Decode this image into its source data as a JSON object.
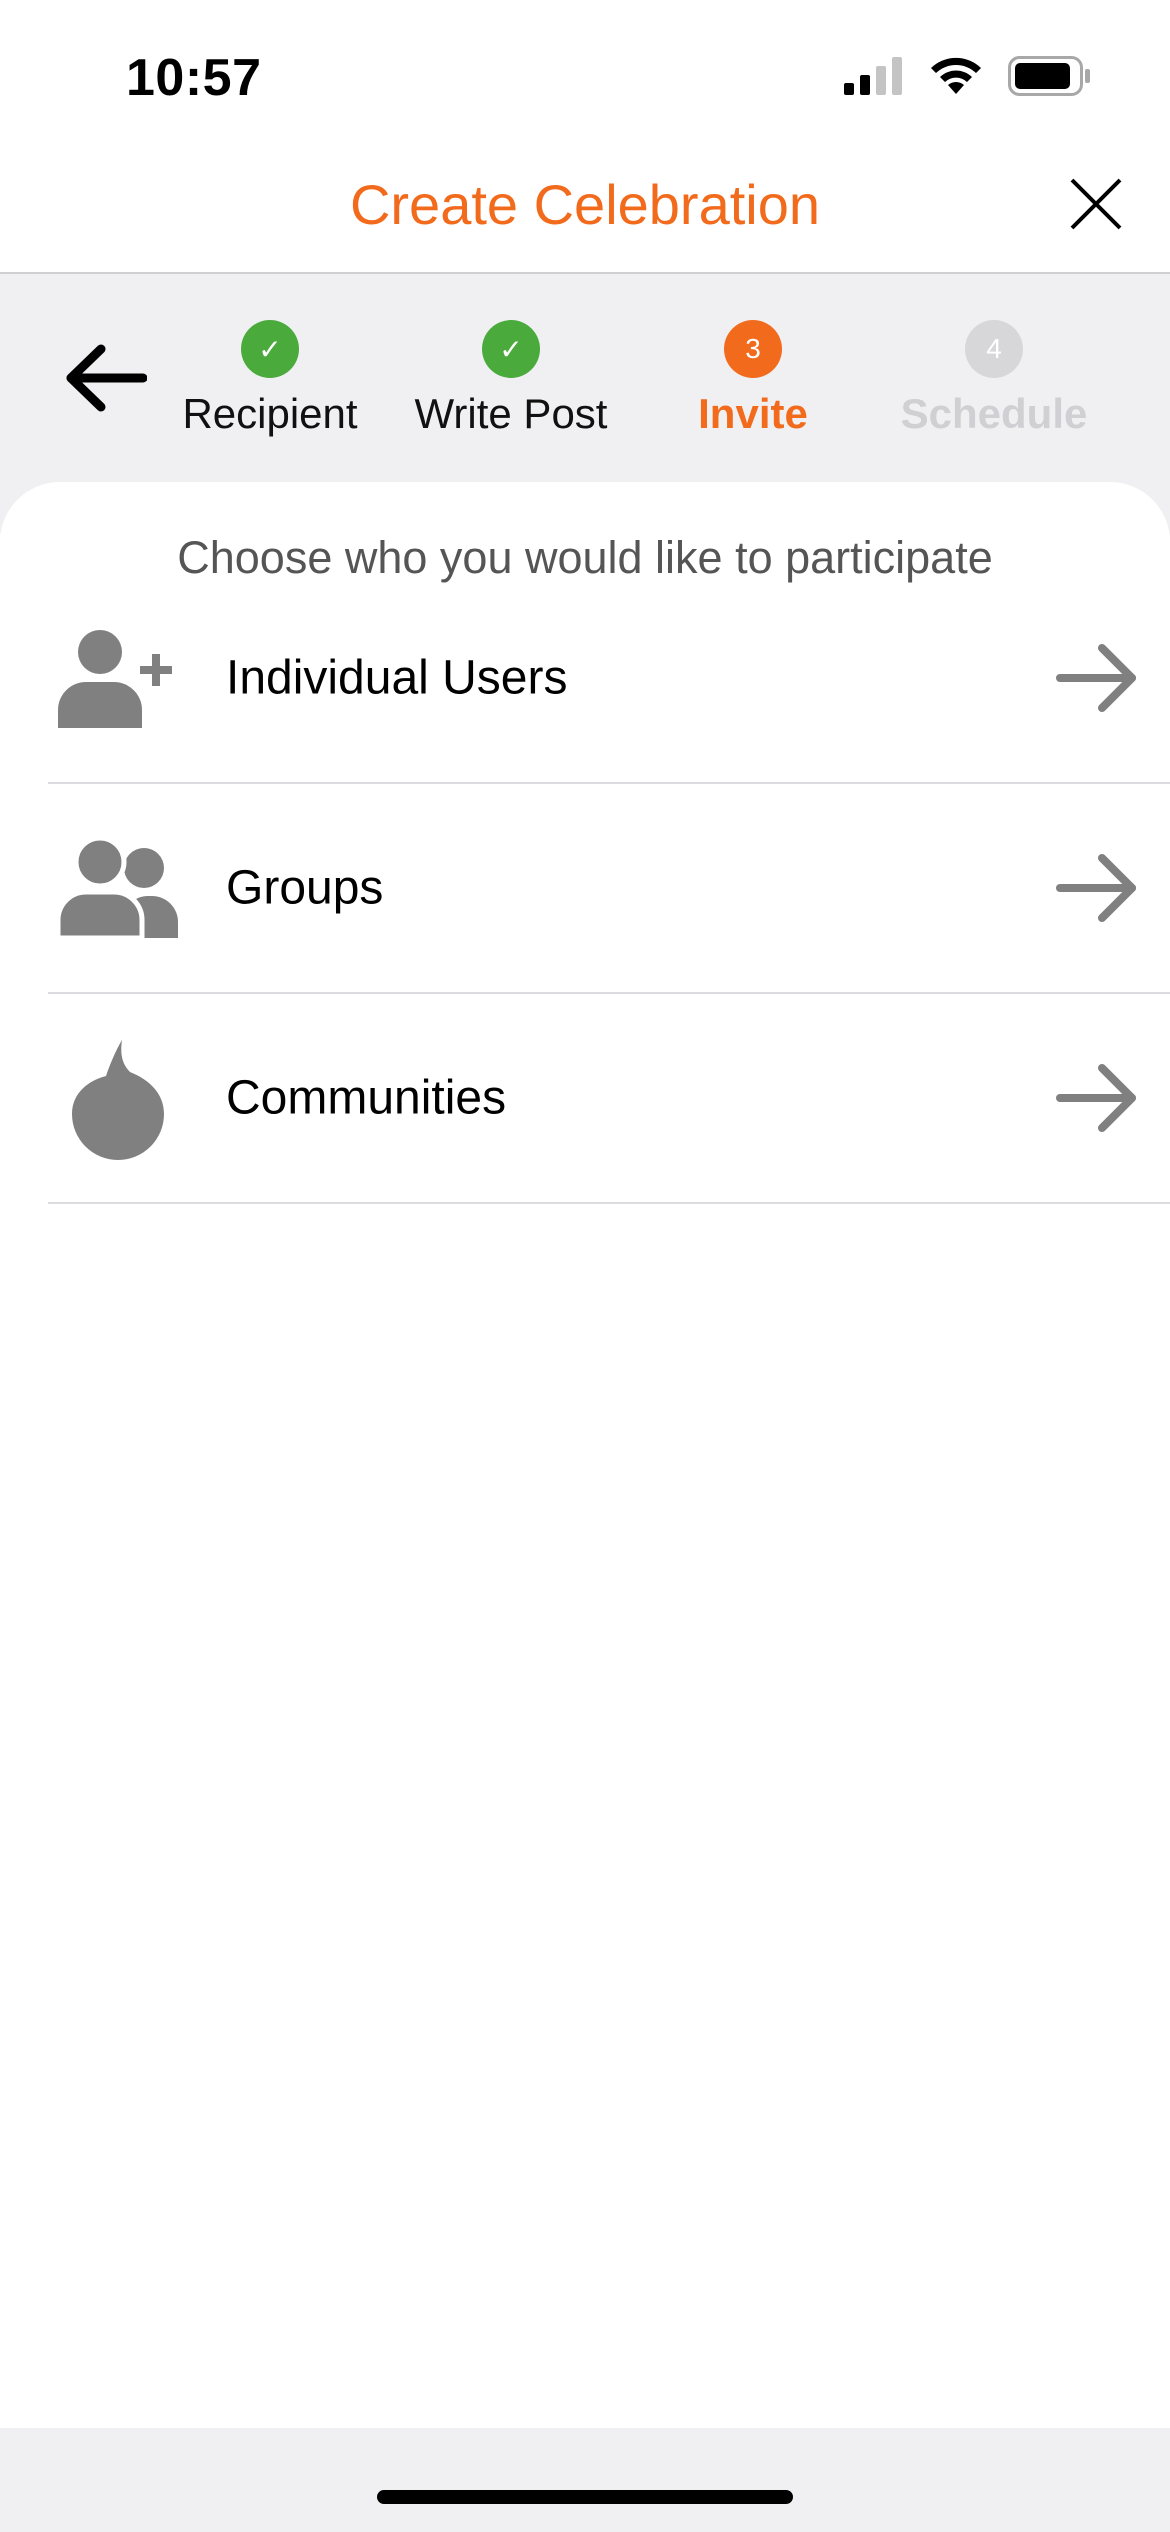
{
  "status_bar": {
    "time": "10:57",
    "icons": [
      "cellular-signal-icon",
      "wifi-icon",
      "battery-icon"
    ]
  },
  "header": {
    "title": "Create Celebration",
    "close_icon": "close-icon",
    "title_color": "#f26b1d"
  },
  "steps": {
    "back_icon": "arrow-left-icon",
    "items": [
      {
        "number": "1",
        "label": "Recipient",
        "state": "done",
        "badge": "✓"
      },
      {
        "number": "2",
        "label": "Write Post",
        "state": "done",
        "badge": "✓"
      },
      {
        "number": "3",
        "label": "Invite",
        "state": "current",
        "badge": "3"
      },
      {
        "number": "4",
        "label": "Schedule",
        "state": "future",
        "badge": "4"
      }
    ],
    "colors": {
      "done": "#4aab3c",
      "current": "#f26b1d",
      "future": "#d7d7da"
    }
  },
  "content": {
    "subtitle": "Choose who you would like to participate",
    "options": [
      {
        "label": "Individual Users",
        "icon": "add-user-icon"
      },
      {
        "label": "Groups",
        "icon": "users-group-icon"
      },
      {
        "label": "Communities",
        "icon": "flame-icon"
      }
    ],
    "arrow_icon": "arrow-right-icon"
  }
}
